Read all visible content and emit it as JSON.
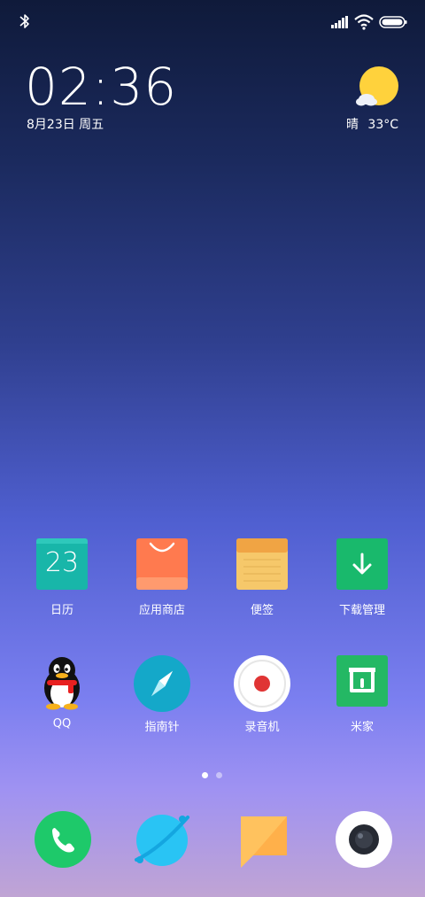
{
  "status_bar": {
    "icons": [
      "bluetooth-icon",
      "signal-icon",
      "wifi-icon",
      "battery-icon"
    ]
  },
  "clock": {
    "time": "02:36",
    "date": "8月23日 周五"
  },
  "weather": {
    "condition": "晴",
    "temperature": "33°C",
    "icon": "sun-cloud-icon"
  },
  "apps_row1": [
    {
      "label": "日历",
      "icon": "calendar-icon",
      "number": "23"
    },
    {
      "label": "应用商店",
      "icon": "shopping-bag-icon"
    },
    {
      "label": "便签",
      "icon": "notepad-icon"
    },
    {
      "label": "下载管理",
      "icon": "download-icon"
    }
  ],
  "apps_row2": [
    {
      "label": "QQ",
      "icon": "penguin-icon"
    },
    {
      "label": "指南针",
      "icon": "compass-icon"
    },
    {
      "label": "录音机",
      "icon": "recorder-icon"
    },
    {
      "label": "米家",
      "icon": "mijia-icon"
    }
  ],
  "dock": [
    {
      "icon": "phone-icon"
    },
    {
      "icon": "browser-icon"
    },
    {
      "icon": "message-icon"
    },
    {
      "icon": "camera-icon"
    }
  ],
  "colors": {
    "calendar": "#18b6a9",
    "store": "#ff7a4f",
    "notes": "#f6c86a",
    "download": "#19b96c",
    "compass": "#14a8c9",
    "mijia": "#24b864",
    "phone": "#1ec96a",
    "browser": "#29c4f4",
    "message": "#ffc25e"
  },
  "page_indicator": {
    "pages": 2,
    "current": 1
  }
}
